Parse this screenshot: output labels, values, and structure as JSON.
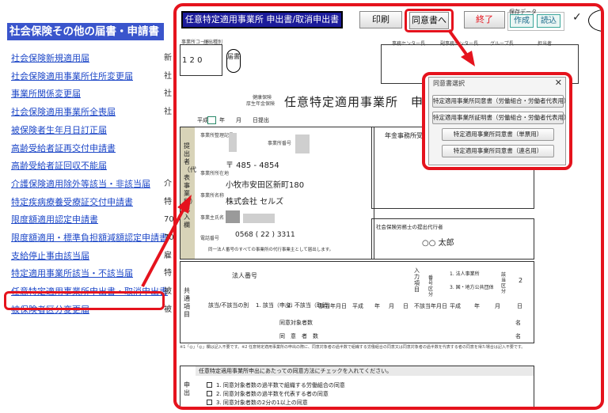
{
  "left_panel": {
    "title": "社会保険その他の届書・申請書",
    "items": [
      {
        "label": "社会保険新規適用届",
        "tail": "新"
      },
      {
        "label": "社会保険適用事業所住所変更届",
        "tail": "社"
      },
      {
        "label": "事業所関係変更届",
        "tail": "社"
      },
      {
        "label": "社会保険適用事業所全喪届",
        "tail": "社"
      },
      {
        "label": "被保険者生年月日訂正届",
        "tail": ""
      },
      {
        "label": "高齢受給者証再交付申請書",
        "tail": ""
      },
      {
        "label": "高齢受給者証回収不能届",
        "tail": ""
      },
      {
        "label": "介護保険適用除外等該当・非該当届",
        "tail": "介"
      },
      {
        "label": "特定疾病療養受療証交付申請書",
        "tail": "特"
      },
      {
        "label": "限度額適用認定申請書",
        "tail": "70"
      },
      {
        "label": "限度額適用・標準負担額減額認定申請書",
        "tail": "70"
      },
      {
        "label": "支給停止事由該当届",
        "tail": "雇"
      },
      {
        "label": "特定適用事業所該当・不該当届",
        "tail": "特"
      },
      {
        "label": "任意特定適用事業所申出書・取消申出書",
        "tail": "被"
      },
      {
        "label": "被保険者区分変更届",
        "tail": "被"
      }
    ]
  },
  "toolbar": {
    "title": "任意特定適用事業所 申出書/取消申出書",
    "print": "印刷",
    "consent": "同意書へ",
    "end": "終了",
    "save_label": "保存データ",
    "create": "作成",
    "load": "読込",
    "check": "✓"
  },
  "form": {
    "office_code_label": "事業所コード",
    "type_code_label": "届出種別",
    "code_value": "1 2 0",
    "stamp": "届書",
    "center_labels": [
      "事務センター長",
      "副事務センター長",
      "グループ長",
      "担当者"
    ],
    "insurance_label_1": "健康保険",
    "insurance_label_2": "厚生年金保険",
    "title": "任意特定適用事業所　申出",
    "date_line": "平成　　年　　月　　日提出",
    "side_label": "提出者（代表事業所）記入欄",
    "f1_label": "事業所整理記号",
    "f2_label": "事業所番号",
    "pension_office": "年金事務所受付",
    "postal": "〒  485  -  4854",
    "address": "小牧市安田区新町180",
    "company": "株式会社  セルズ",
    "addr_label": "事業所所在地",
    "name_label": "事業所名称",
    "owner_label": "事業主氏名",
    "phone_label": "電話番号",
    "phone": "0568  (  22  )  3311",
    "note_same": "同一法人番号のすべての事業所の代行事業主として届出します。",
    "agent_label": "社会保険労務士の提出代行者",
    "agent_name": "○○ 太郎",
    "common_label": "共通項目",
    "corp_no_label": "法人番号",
    "input_label": "入力項目",
    "kubun_label": "番号区分",
    "opt1": "1. 法人事業所",
    "opt2": "3. 国・地方公共団体",
    "gaito_label": "該当区分",
    "gaito_val": "2",
    "applic_label": "該当/不該当の別",
    "applic1": "1. 該当（申出）",
    "applic2": "2. 不該当（取消）",
    "date1_label": "該当年月日",
    "date2_label": "不該当年月日",
    "heisei": "平成",
    "y": "年",
    "m": "月",
    "d": "日",
    "count_label": "同意対象者数",
    "count_label2": "同　意　者　数",
    "mei": "名",
    "notes": "※1「◎」「◎」欄は記入不要です。※2 任意特定適用事業所の申出の際に、同意対象者の過半数で組織する労働組合の同意又は同意対象者の過半数を代表する者の同意を得た場合は記入不要です。",
    "consent_head": "任意特定適用事業所申出にあたっての同意方法にチェックを入れてください。",
    "apply_label": "申出",
    "consent1": "1. 同意対象者数の過半数で組織する労働組合の同意",
    "consent2": "2. 同意対象者数の過半数を代表する者の同意",
    "consent3": "3. 同意対象者数の2分の1以上の同意"
  },
  "dialog": {
    "title": "同意書選択",
    "close": "✕",
    "buttons": [
      "特定適用事業所同意書（労働組合・労働者代表用）",
      "特定適用事業所証明書（労働組合・労働者代表用）",
      "特定適用事業所同意書（単票用）",
      "特定適用事業所同意書（連名用）"
    ]
  },
  "colors": {
    "highlight": "#e5131d",
    "link": "#1f49c8",
    "title_bg": "#3a55cc"
  }
}
